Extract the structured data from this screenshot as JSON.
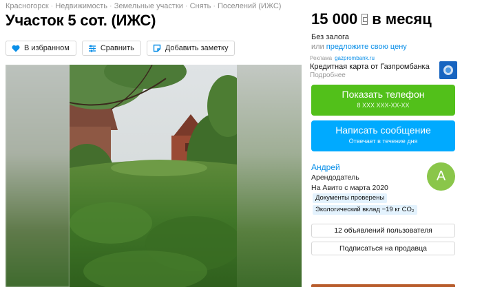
{
  "breadcrumbs": [
    "Красногорск",
    "Недвижимость",
    "Земельные участки",
    "Снять",
    "Поселений (ИЖС)"
  ],
  "title": "Участок 5 сот. (ИЖС)",
  "actions": {
    "favorite": "В избранном",
    "compare": "Сравнить",
    "note": "Добавить заметку"
  },
  "price": {
    "amount": "15 000",
    "period": "в месяц",
    "deposit": "Без залога",
    "suggest_prefix": "или",
    "suggest_link": "предложите свою цену"
  },
  "ad": {
    "label": "Реклама",
    "domain": "gazprombank.ru",
    "name": "Кредитная карта от Газпромбанка",
    "more": "Подробнее"
  },
  "buttons": {
    "phone_title": "Показать телефон",
    "phone_sub": "8 XXX XXX-XX-XX",
    "msg_title": "Написать сообщение",
    "msg_sub": "Отвечает в течение дня"
  },
  "seller": {
    "name": "Андрей",
    "role": "Арендодатель",
    "since": "На Авито с марта 2020",
    "avatar_letter": "А",
    "badge_docs": "Документы проверены",
    "badge_eco": "Экологический вклад −19 кг CO₂",
    "ads_button": "12 объявлений пользователя",
    "subscribe_button": "Подписаться на продавца"
  },
  "colors": {
    "green": "#52c01a",
    "blue": "#00aaff",
    "link": "#0a8fe8",
    "avatar": "#8ac64a"
  }
}
